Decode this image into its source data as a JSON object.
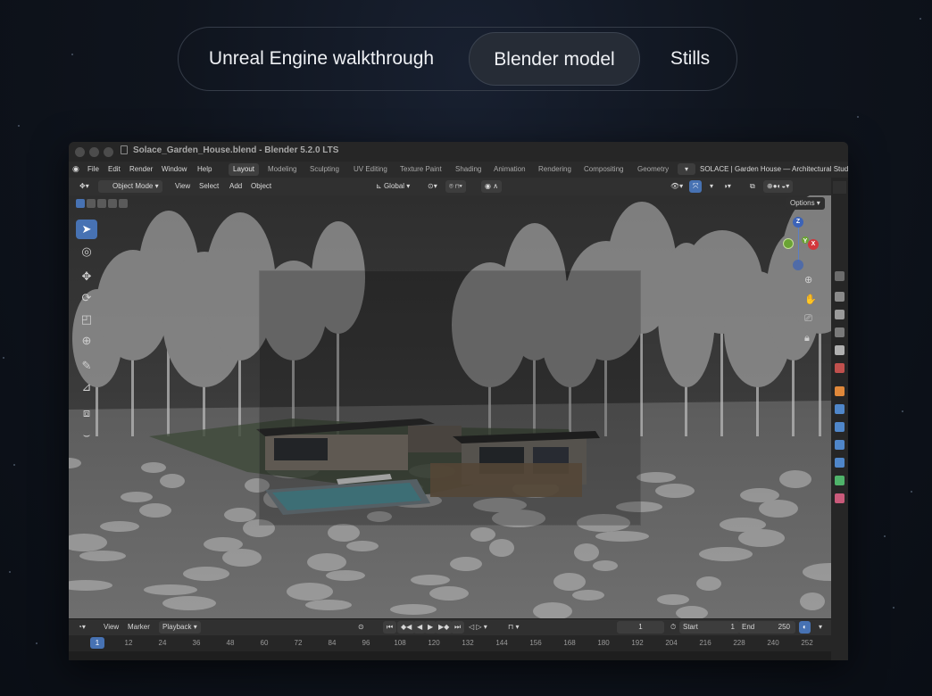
{
  "tabs": [
    {
      "label": "Unreal Engine walkthrough"
    },
    {
      "label": "Blender model"
    },
    {
      "label": "Stills"
    }
  ],
  "window": {
    "title": "Solace_Garden_House.blend - Blender 5.2.0 LTS"
  },
  "menus": [
    "File",
    "Edit",
    "Render",
    "Window",
    "Help"
  ],
  "workspaces": [
    "Layout",
    "Modeling",
    "Sculpting",
    "UV Editing",
    "Texture Paint",
    "Shading",
    "Animation",
    "Rendering",
    "Compositing",
    "Geometry"
  ],
  "scene_name": "SOLACE | Garden House — Architectural Stud",
  "viewport_header": {
    "mode": "Object Mode",
    "view": "View",
    "select": "Select",
    "add": "Add",
    "object": "Object",
    "orientation": "Global",
    "options": "Options"
  },
  "gizmo": {
    "z": "Z",
    "y": "Y",
    "x": "X"
  },
  "timeline": {
    "view": "View",
    "marker": "Marker",
    "playback": "Playback",
    "current_frame": "1",
    "start_label": "Start",
    "start": "1",
    "end_label": "End",
    "end": "250"
  },
  "ruler": {
    "current": "1",
    "ticks": [
      "12",
      "24",
      "36",
      "48",
      "60",
      "72",
      "84",
      "96",
      "108",
      "120",
      "132",
      "144",
      "156",
      "168",
      "180",
      "192",
      "204",
      "216",
      "228",
      "240",
      "252"
    ]
  },
  "colors": {
    "accent": "#4772b3",
    "background": "#0d121b",
    "tab_active": "#262c36"
  }
}
